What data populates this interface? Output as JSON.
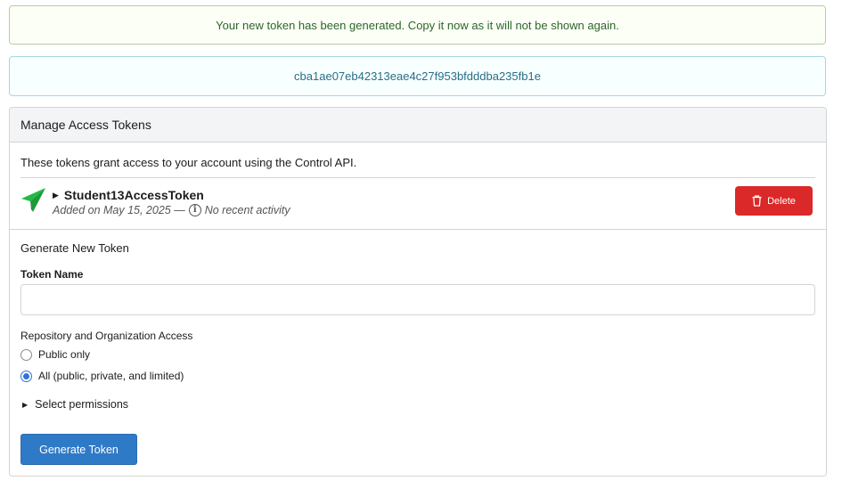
{
  "flash": {
    "success_message": "Your new token has been generated. Copy it now as it will not be shown again.",
    "token_value": "cba1ae07eb42313eae4c27f953bfdddba235fb1e"
  },
  "panel": {
    "header": "Manage Access Tokens",
    "description": "These tokens grant access to your account using the Control API.",
    "tokens": [
      {
        "name": "Student13AccessToken",
        "added": "Added on May 15, 2025 —",
        "activity": "No recent activity",
        "icon": "send-icon",
        "icon_color": "#21ba45",
        "delete_label": "Delete"
      }
    ]
  },
  "generate": {
    "title": "Generate New Token",
    "token_name_label": "Token Name",
    "token_name_value": "",
    "access_label": "Repository and Organization Access",
    "options": [
      {
        "label": "Public only",
        "checked": false
      },
      {
        "label": "All (public, private, and limited)",
        "checked": true
      }
    ],
    "select_permissions": "Select permissions",
    "button_label": "Generate Token"
  },
  "colors": {
    "success_bg": "#fcfff5",
    "success_text": "#2c662d",
    "info_bg": "#f8ffff",
    "info_text": "#276f86",
    "danger": "#db2828",
    "primary": "#2f7ac6"
  }
}
